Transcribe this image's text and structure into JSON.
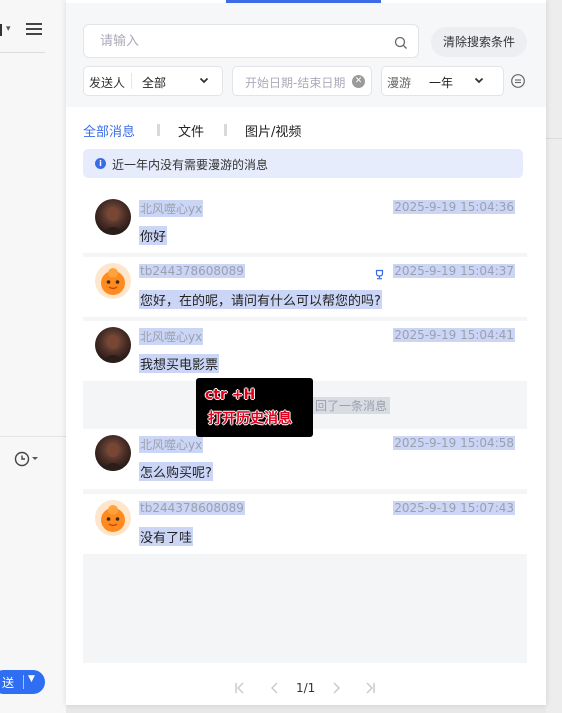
{
  "left_pane": {
    "send_label": "送"
  },
  "search": {
    "placeholder": "请输入",
    "clear_button": "清除搜索条件"
  },
  "filters": {
    "sender_label": "发送人",
    "sender_value": "全部",
    "date_placeholder": "开始日期-结束日期",
    "roam_label": "漫游",
    "roam_value": "一年"
  },
  "tabs": [
    {
      "label": "全部消息",
      "active": true
    },
    {
      "label": "文件",
      "active": false
    },
    {
      "label": "图片/视频",
      "active": false
    }
  ],
  "notice": "近一年内没有需要漫游的消息",
  "messages": [
    {
      "sender": "北风噬心yx",
      "time": "2025-9-19 15:04:36",
      "content": "你好",
      "avatar": "dark-avatar"
    },
    {
      "sender": "tb244378608089",
      "time": "2025-9-19 15:04:37",
      "content": "您好，在的呢，请问有什么可以帮您的吗?",
      "avatar": "orange-mascot-avatar"
    },
    {
      "sender": "北风噬心yx",
      "time": "2025-9-19 15:04:41",
      "content": "我想买电影票",
      "avatar": "dark-avatar"
    },
    {
      "sender": "北风噬心yx",
      "time": "2025-9-19 15:04:58",
      "content": "怎么购买呢?",
      "avatar": "dark-avatar"
    },
    {
      "sender": "tb244378608089",
      "time": "2025-9-19 15:07:43",
      "content": "没有了哇",
      "avatar": "orange-mascot-avatar"
    }
  ],
  "recall_notice": "回了一条消息",
  "tooltip": {
    "line1": "ctr +H",
    "line2": "打开历史消息"
  },
  "pager": {
    "page_text": "1/1"
  },
  "colors": {
    "accent": "#3b6ce6",
    "selection": "#cbd6f7",
    "notice_bg": "#e6ecfb",
    "tooltip_text": "#e0001b"
  }
}
